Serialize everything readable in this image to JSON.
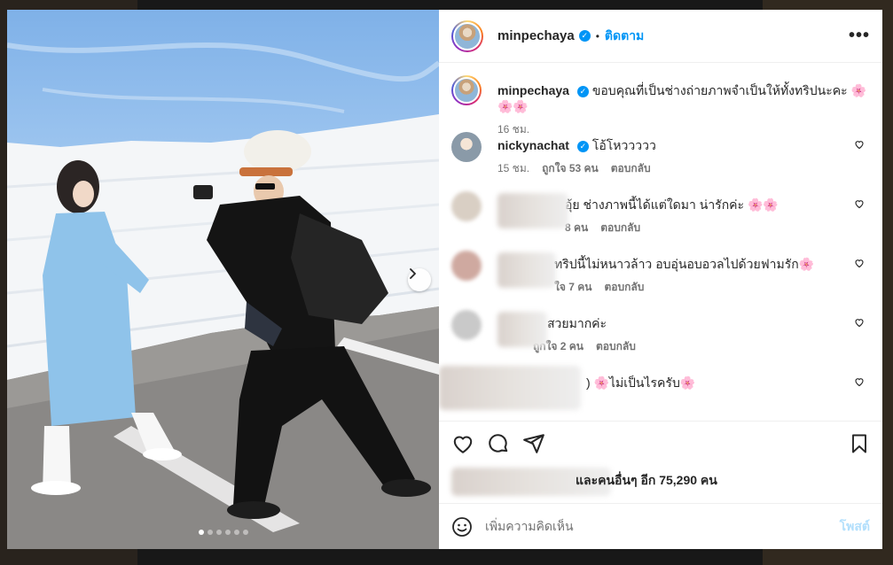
{
  "colors": {
    "accent": "#0095f6",
    "muted_text": "#737373",
    "post_disabled": "#b2dffc"
  },
  "photo": {
    "carousel_dots": 6,
    "active_dot": 0,
    "next_icon": "chevron-right-icon"
  },
  "header": {
    "username": "minpechaya",
    "separator": "•",
    "follow_label": "ติดตาม",
    "more_icon": "more-horizontal-icon"
  },
  "caption": {
    "username": "minpechaya",
    "text": "ขอบคุณที่เป็นช่างถ่ายภาพจำเป็นให้ทั้งทริปนะคะ 🌸🌸🌸",
    "time": "16 ชม."
  },
  "comments": [
    {
      "username": "nickynachat",
      "verified": true,
      "text": "โอ้โหววววว",
      "time": "15 ชม.",
      "likes": "ถูกใจ 53 คน",
      "reply": "ตอบกลับ"
    },
    {
      "username": "",
      "text": "อุ้ย ช่างภาพนี้ได้แต่ใดมา น่ารักค่ะ 🌸🌸",
      "time": "",
      "likes": "8 คน",
      "reply": "ตอบกลับ"
    },
    {
      "username": "",
      "text": "ทริปนี้ไม่หนาวล้าว อบอุ่นอบอวลไปด้วยฟามรัก🌸",
      "time": "",
      "likes": "ใจ 7 คน",
      "reply": "ตอบกลับ"
    },
    {
      "username": "",
      "text": "สวยมากค่ะ",
      "time": "",
      "likes": "ถูกใจ 2 คน",
      "reply": "ตอบกลับ"
    },
    {
      "username": "",
      "text": ") 🌸ไม่เป็นไรครับ🌸",
      "time": "",
      "likes": "",
      "reply": ""
    }
  ],
  "actions": {
    "like_icon": "heart-icon",
    "comment_icon": "comment-icon",
    "share_icon": "send-icon",
    "save_icon": "bookmark-icon",
    "likes_summary": "และคนอื่นๆ อีก 75,290 คน"
  },
  "add_comment": {
    "emoji_icon": "emoji-icon",
    "placeholder": "เพิ่มความคิดเห็น",
    "post_label": "โพสต์"
  }
}
